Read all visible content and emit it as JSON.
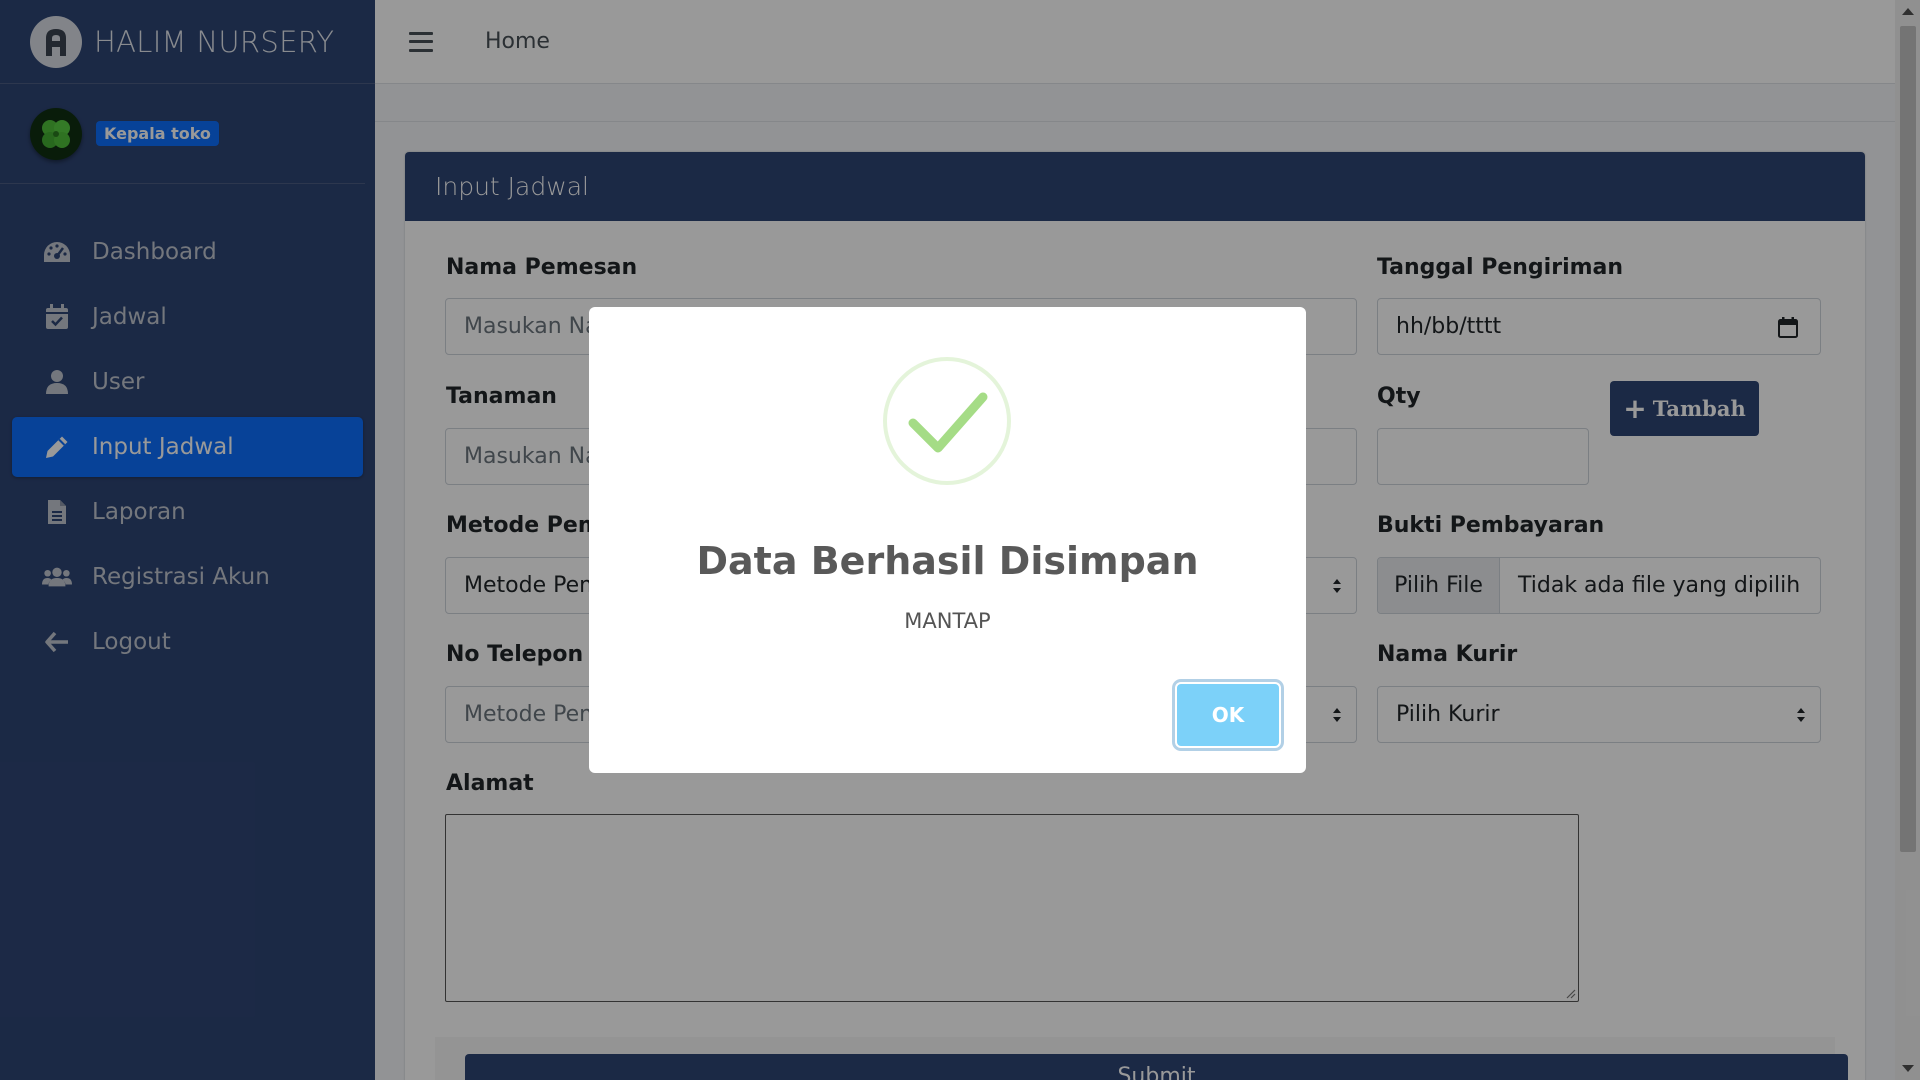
{
  "brand": {
    "name": "HALIM NURSERY"
  },
  "user_panel": {
    "role": "Kepala toko"
  },
  "sidebar": {
    "items": [
      {
        "label": "Dashboard",
        "icon": "dashboard-gauge-icon"
      },
      {
        "label": "Jadwal",
        "icon": "calendar-icon"
      },
      {
        "label": "User",
        "icon": "user-icon"
      },
      {
        "label": "Input Jadwal",
        "icon": "pencil-icon",
        "active": true
      },
      {
        "label": "Laporan",
        "icon": "file-icon"
      },
      {
        "label": "Registrasi Akun",
        "icon": "users-icon"
      },
      {
        "label": "Logout",
        "icon": "arrow-left-icon"
      }
    ]
  },
  "topbar": {
    "home": "Home"
  },
  "card": {
    "title": "Input Jadwal"
  },
  "form": {
    "nama_pemesan": {
      "label": "Nama Pemesan",
      "placeholder": "Masukan Na"
    },
    "tanggal_pengiriman": {
      "label": "Tanggal Pengiriman",
      "value": "hh/bb/tttt"
    },
    "tanaman": {
      "label": "Tanaman",
      "placeholder": "Masukan Na"
    },
    "qty": {
      "label": "Qty",
      "value": ""
    },
    "tambah_button": "Tambah",
    "metode_pembayaran": {
      "label": "Metode Pemb",
      "value": "Metode Pem"
    },
    "bukti_pembayaran": {
      "label": "Bukti Pembayaran",
      "button": "Pilih File",
      "status": "Tidak ada file yang dipilih"
    },
    "no_telepon": {
      "label": "No Telepon",
      "placeholder": "Metode Pem"
    },
    "nama_kurir": {
      "label": "Nama Kurir",
      "value": "Pilih Kurir"
    },
    "alamat": {
      "label": "Alamat",
      "value": ""
    },
    "submit_button": "Submit"
  },
  "modal": {
    "title": "Data Berhasil Disimpan",
    "text": "MANTAP",
    "ok_button": "OK",
    "colors": {
      "check": "#a5dc86",
      "ok_button": "#7cd1f9"
    }
  },
  "colors": {
    "sidebar": "#2e4574",
    "active": "#0d6efd",
    "primary": "#2e4574"
  }
}
